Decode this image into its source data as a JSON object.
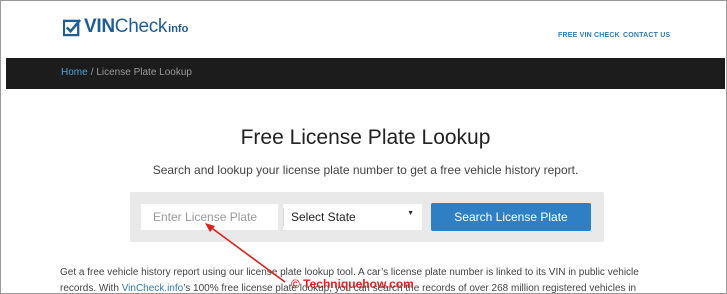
{
  "header": {
    "logo": {
      "vin": "VIN",
      "check": "Check",
      "info": "info"
    },
    "nav": {
      "free_vin_check": "FREE VIN CHECK",
      "contact_us": "CONTACT US"
    }
  },
  "breadcrumb": {
    "home": "Home",
    "current": " / License Plate Lookup"
  },
  "main": {
    "title": "Free License Plate Lookup",
    "subtitle": "Search and lookup your license plate number to get a free vehicle history report.",
    "plate_input": {
      "placeholder": "Enter License Plate",
      "value": ""
    },
    "state_select": {
      "selected": "Select State"
    },
    "search_button": "Search License Plate",
    "paragraph": {
      "line1": "Get a free vehicle history report using our license plate lookup tool. A car’s license plate number is linked to its VIN in public vehicle",
      "line2_prefix": "records. With ",
      "line2_link": "VinCheck.info",
      "line2_suffix": "’s 100% free license plate lookup, you can search the records of over 268 million registered vehicles in"
    }
  },
  "annotation": {
    "watermark": "© Techniquehow.com",
    "arrow_color": "#d8231e"
  },
  "colors": {
    "brand": "#1f5d97",
    "link": "#2b7bbd",
    "button": "#2f7fc4",
    "breadcrumb_bg": "#1c1c1c"
  }
}
